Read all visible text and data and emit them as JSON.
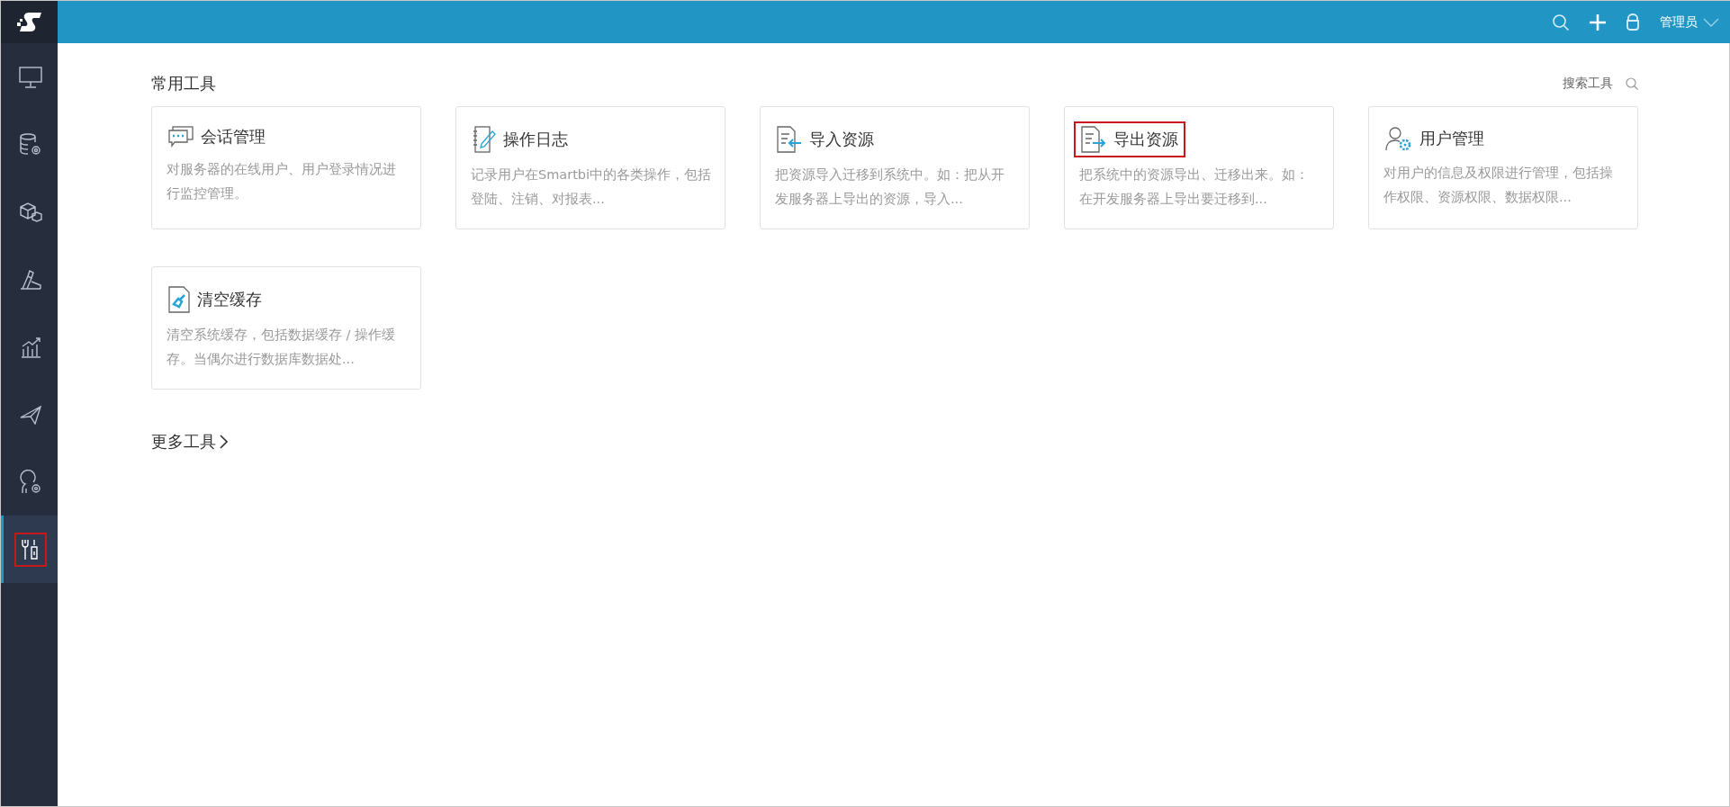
{
  "topbar": {
    "user": "管理员"
  },
  "sidebar": {
    "items": [
      {
        "selected": false,
        "highlighted": false
      },
      {
        "selected": false,
        "highlighted": false
      },
      {
        "selected": false,
        "highlighted": false
      },
      {
        "selected": false,
        "highlighted": false
      },
      {
        "selected": false,
        "highlighted": false
      },
      {
        "selected": false,
        "highlighted": false
      },
      {
        "selected": false,
        "highlighted": false
      },
      {
        "selected": true,
        "highlighted": true
      }
    ]
  },
  "section": {
    "title": "常用工具",
    "search_label": "搜索工具"
  },
  "tools": [
    {
      "title": "会话管理",
      "description": "对服务器的在线用户、用户登录情况进行监控管理。",
      "highlighted": false
    },
    {
      "title": "操作日志",
      "description": "记录用户在Smartbi中的各类操作，包括登陆、注销、对报表...",
      "highlighted": false
    },
    {
      "title": "导入资源",
      "description": "把资源导入迁移到系统中。如：把从开发服务器上导出的资源，导入...",
      "highlighted": false
    },
    {
      "title": "导出资源",
      "description": "把系统中的资源导出、迁移出来。如：在开发服务器上导出要迁移到...",
      "highlighted": true
    },
    {
      "title": "用户管理",
      "description": "对用户的信息及权限进行管理，包括操作权限、资源权限、数据权限...",
      "highlighted": false
    },
    {
      "title": "清空缓存",
      "description": "清空系统缓存，包括数据缓存 / 操作缓存。当偶尔进行数据库数据处...",
      "highlighted": false
    }
  ],
  "more_link": "更多工具"
}
